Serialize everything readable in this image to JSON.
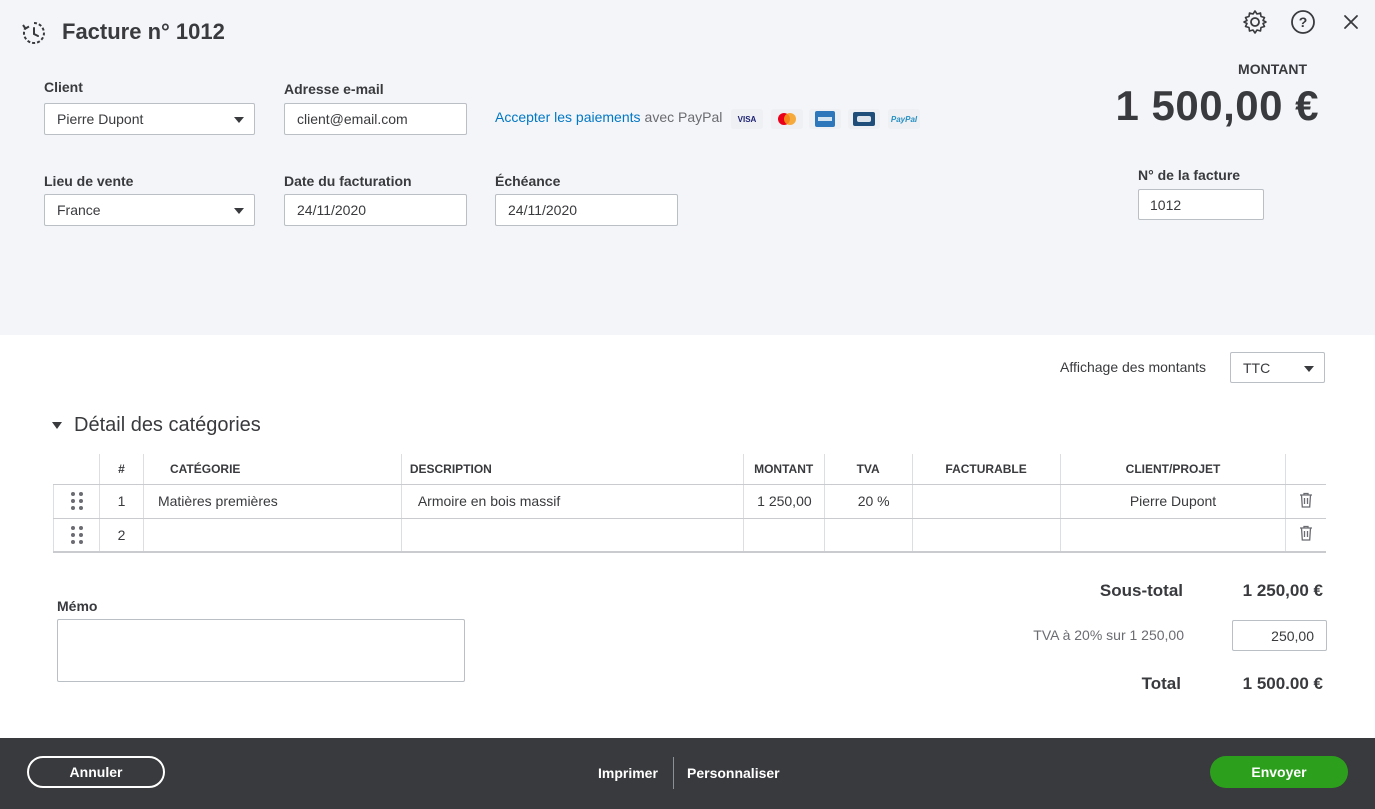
{
  "header": {
    "title": "Facture n° 1012",
    "settings_icon": "gear-icon",
    "help_icon": "help-icon",
    "close_icon": "close-icon"
  },
  "form": {
    "client_label": "Client",
    "client_value": "Pierre Dupont",
    "email_label": "Adresse e-mail",
    "email_value": "client@email.com",
    "paypal_link": "Accepter les paiements",
    "paypal_text": "avec PayPal",
    "cards": [
      "VISA",
      "MC",
      "AMEX",
      "CB",
      "PayPal"
    ],
    "lieu_label": "Lieu de vente",
    "lieu_value": "France",
    "date_label": "Date du facturation",
    "date_value": "24/11/2020",
    "echeance_label": "Échéance",
    "echeance_value": "24/11/2020",
    "montant_label": "MONTANT",
    "montant_value": "1 500,00 €",
    "invoice_no_label": "N° de la facture",
    "invoice_no_value": "1012"
  },
  "display": {
    "label": "Affichage des montants",
    "value": "TTC"
  },
  "categories": {
    "title": "Détail des catégories",
    "columns": [
      "#",
      "CATÉGORIE",
      "DESCRIPTION",
      "MONTANT",
      "TVA",
      "FACTURABLE",
      "CLIENT/PROJET"
    ],
    "rows": [
      {
        "num": "1",
        "categorie": "Matières premières",
        "description": "Armoire en bois massif",
        "montant": "1 250,00",
        "tva": "20 %",
        "facturable": "",
        "client": "Pierre Dupont"
      },
      {
        "num": "2",
        "categorie": "",
        "description": "",
        "montant": "",
        "tva": "",
        "facturable": "",
        "client": ""
      }
    ]
  },
  "memo": {
    "label": "Mémo"
  },
  "totals": {
    "subtotal_label": "Sous-total",
    "subtotal_value": "1 250,00 €",
    "tva_label": "TVA à 20% sur 1 250,00",
    "tva_value": "250,00",
    "total_label": "Total",
    "total_value": "1 500.00 €"
  },
  "footer": {
    "cancel": "Annuler",
    "print": "Imprimer",
    "customize": "Personnaliser",
    "send": "Envoyer"
  },
  "colors": {
    "accent": "#2ca01c",
    "link": "#0077c5",
    "footer_bg": "#393a3d",
    "top_bg": "#f4f5f8"
  }
}
